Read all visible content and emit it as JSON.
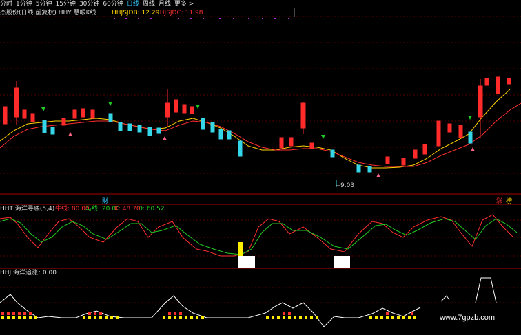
{
  "toolbar": {
    "items": [
      "分时",
      "1分钟",
      "5分钟",
      "15分钟",
      "30分钟",
      "60分钟",
      "日线",
      "周线",
      "月线",
      "更多 >"
    ],
    "active_index": 6
  },
  "main": {
    "title": "杰股份(日线,前复权) HHY 慧眼K线",
    "hhjsjdb_label": "HHJSJDB: 12.29",
    "hhjsjdc_label": "HHJSJDC: 11.98",
    "min_price_label": "9.03",
    "bottom_left_tag": "财",
    "bottom_right_tags": [
      "涨",
      "榜"
    ]
  },
  "sub1": {
    "title": "HHT 海洋寻底(5,4)",
    "tag1": "牛线: 80.00",
    "tag2": "马线: 20.00",
    "k": "K: 48.70",
    "d": "D: 60.52"
  },
  "sub2": {
    "title": "HHJ 海洋追涨",
    "value": ": 0.00"
  },
  "watermark": "www.7gpzb.com",
  "colors": {
    "up": "#ff2b2b",
    "down": "#34d6e8",
    "ma1": "#ffd200",
    "ma2": "#ff3030",
    "green": "#22cc22",
    "white": "#ffffff",
    "yellow": "#ffee00"
  }
}
